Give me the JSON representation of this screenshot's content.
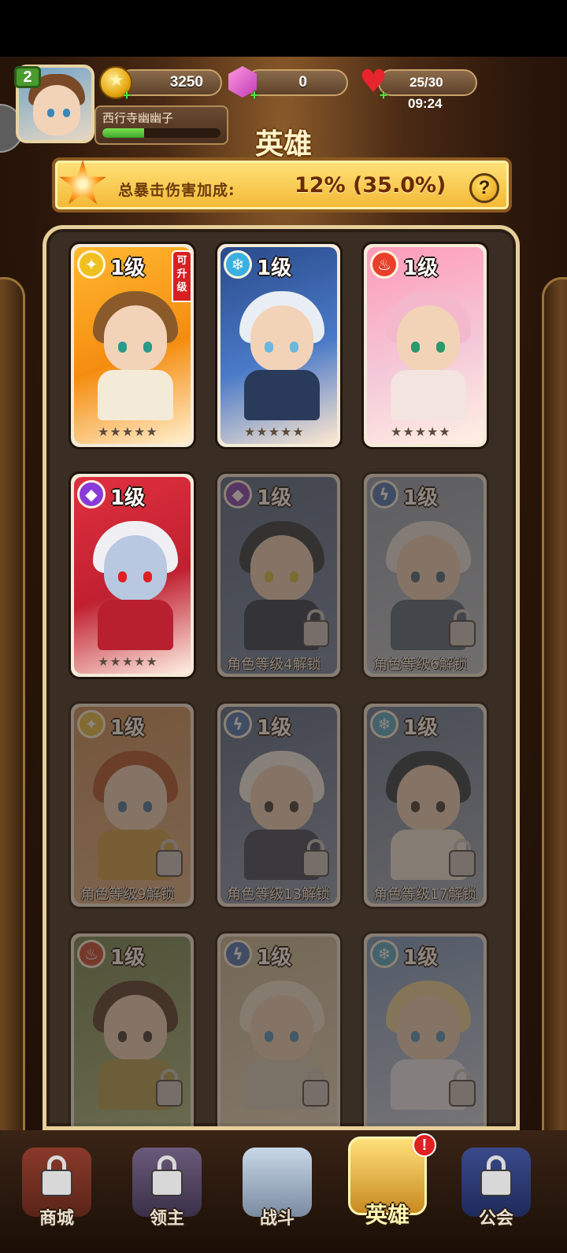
{
  "player": {
    "level": "2",
    "name": "西行寺幽幽子",
    "xp_fraction": 0.35
  },
  "resources": {
    "gold": "3250",
    "gems": "0",
    "energy": "25/30",
    "energy_timer": "09:24",
    "plus_symbol": "+"
  },
  "page": {
    "title": "英雄"
  },
  "crit_bonus": {
    "label": "总暴击伤害加成:",
    "value": "12% (35.0%)",
    "help_symbol": "?"
  },
  "heroes": [
    {
      "level_label": "1级",
      "element": "light",
      "element_glyph": "✦",
      "element_color": "#f0c020",
      "stars": "★★★★★",
      "upgrade_tag": "可升级",
      "locked": false,
      "unlock_text": ""
    },
    {
      "level_label": "1级",
      "element": "ice",
      "element_glyph": "❄",
      "element_color": "#38b0e0",
      "stars": "★★★★★",
      "upgrade_tag": "",
      "locked": false,
      "unlock_text": ""
    },
    {
      "level_label": "1级",
      "element": "fire",
      "element_glyph": "♨",
      "element_color": "#e8402a",
      "stars": "★★★★★",
      "upgrade_tag": "",
      "locked": false,
      "unlock_text": ""
    },
    {
      "level_label": "1级",
      "element": "shadow",
      "element_glyph": "◆",
      "element_color": "#8a3ad8",
      "stars": "★★★★★",
      "upgrade_tag": "",
      "locked": false,
      "unlock_text": ""
    },
    {
      "level_label": "1级",
      "element": "shadow",
      "element_glyph": "◆",
      "element_color": "#8a3ad8",
      "stars": "",
      "upgrade_tag": "",
      "locked": true,
      "unlock_text": "角色等级4解锁"
    },
    {
      "level_label": "1级",
      "element": "lightning",
      "element_glyph": "ϟ",
      "element_color": "#3a78d8",
      "stars": "",
      "upgrade_tag": "",
      "locked": true,
      "unlock_text": "角色等级6解锁"
    },
    {
      "level_label": "1级",
      "element": "light",
      "element_glyph": "✦",
      "element_color": "#f0c020",
      "stars": "",
      "upgrade_tag": "",
      "locked": true,
      "unlock_text": "角色等级9解锁"
    },
    {
      "level_label": "1级",
      "element": "lightning",
      "element_glyph": "ϟ",
      "element_color": "#3a78d8",
      "stars": "",
      "upgrade_tag": "",
      "locked": true,
      "unlock_text": "角色等级13解锁"
    },
    {
      "level_label": "1级",
      "element": "ice",
      "element_glyph": "❄",
      "element_color": "#38b0e0",
      "stars": "",
      "upgrade_tag": "",
      "locked": true,
      "unlock_text": "角色等级17解锁"
    },
    {
      "level_label": "1级",
      "element": "fire",
      "element_glyph": "♨",
      "element_color": "#e8402a",
      "stars": "",
      "upgrade_tag": "",
      "locked": true,
      "unlock_text": ""
    },
    {
      "level_label": "1级",
      "element": "lightning",
      "element_glyph": "ϟ",
      "element_color": "#3a78d8",
      "stars": "",
      "upgrade_tag": "",
      "locked": true,
      "unlock_text": ""
    },
    {
      "level_label": "1级",
      "element": "ice",
      "element_glyph": "❄",
      "element_color": "#38b0e0",
      "stars": "",
      "upgrade_tag": "",
      "locked": true,
      "unlock_text": ""
    }
  ],
  "nav": {
    "items": [
      {
        "label": "商城",
        "locked": true,
        "active": false
      },
      {
        "label": "领主",
        "locked": true,
        "active": false
      },
      {
        "label": "战斗",
        "locked": false,
        "active": false
      },
      {
        "label": "英雄",
        "locked": false,
        "active": true
      },
      {
        "label": "公会",
        "locked": true,
        "active": false
      }
    ],
    "alert_symbol": "!"
  },
  "colors": {
    "accent_gold": "#f3b733",
    "frame_cream": "#e6cf9a",
    "alert_red": "#e02020"
  }
}
